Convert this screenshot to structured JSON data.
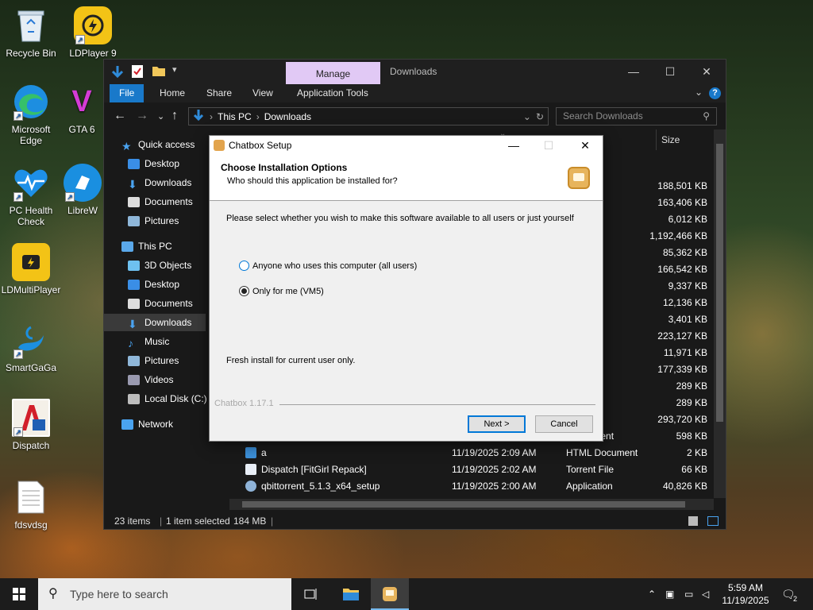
{
  "desktop": {
    "icons": [
      {
        "label": "Recycle Bin",
        "icon": "recycle-bin-icon"
      },
      {
        "label": "LDPlayer 9",
        "icon": "ldplayer-icon"
      },
      {
        "label": "Microsoft Edge",
        "icon": "edge-icon"
      },
      {
        "label": "GTA 6",
        "icon": "gta-icon"
      },
      {
        "label": "PC Health Check",
        "icon": "pc-health-icon"
      },
      {
        "label": "LibreW",
        "icon": "libre-icon"
      },
      {
        "label": "LDMultiPlayer",
        "icon": "ldmultiplayer-icon"
      },
      {
        "label": "SmartGaGa",
        "icon": "smartgaga-icon"
      },
      {
        "label": "Dispatch",
        "icon": "dispatch-icon"
      },
      {
        "label": "fdsvdsg",
        "icon": "text-file-icon"
      }
    ]
  },
  "explorer": {
    "manage_tab": "Manage",
    "window_title": "Downloads",
    "tabs": [
      "File",
      "Home",
      "Share",
      "View",
      "Application Tools"
    ],
    "breadcrumb": [
      "This PC",
      "Downloads"
    ],
    "search_placeholder": "Search Downloads",
    "nav": [
      {
        "label": "Quick access"
      },
      {
        "label": "Desktop"
      },
      {
        "label": "Downloads"
      },
      {
        "label": "Documents"
      },
      {
        "label": "Pictures"
      },
      {
        "label": "This PC"
      },
      {
        "label": "3D Objects"
      },
      {
        "label": "Desktop"
      },
      {
        "label": "Documents"
      },
      {
        "label": "Downloads"
      },
      {
        "label": "Music"
      },
      {
        "label": "Pictures"
      },
      {
        "label": "Videos"
      },
      {
        "label": "Local Disk (C:)"
      },
      {
        "label": "Network"
      }
    ],
    "size_header": "Size",
    "partial_rows": [
      {
        "type": "on",
        "size": "188,501 KB"
      },
      {
        "type": "on",
        "size": "163,406 KB"
      },
      {
        "type": "on",
        "size": "6,012 KB"
      },
      {
        "type": "on",
        "size": "1,192,466 KB"
      },
      {
        "type": "on",
        "size": "85,362 KB"
      },
      {
        "type": "on",
        "size": "166,542 KB"
      },
      {
        "type": "on",
        "size": "9,337 KB"
      },
      {
        "type": "",
        "size": "12,136 KB"
      },
      {
        "type": "on",
        "size": "3,401 KB"
      },
      {
        "type": "",
        "size": "223,127 KB"
      },
      {
        "type": "",
        "size": "11,971 KB"
      },
      {
        "type": "e",
        "size": "177,339 KB"
      },
      {
        "type": "on",
        "size": "289 KB"
      },
      {
        "type": "on",
        "size": "289 KB"
      },
      {
        "type": "on",
        "size": "293,720 KB"
      },
      {
        "type": "ocument",
        "size": "598 KB"
      }
    ],
    "rows": [
      {
        "name": "a",
        "date": "11/19/2025 2:09 AM",
        "type": "HTML Document",
        "size": "2 KB"
      },
      {
        "name": "Dispatch [FitGirl Repack]",
        "date": "11/19/2025 2:02 AM",
        "type": "Torrent File",
        "size": "66 KB"
      },
      {
        "name": "qbittorrent_5.1.3_x64_setup",
        "date": "11/19/2025 2:00 AM",
        "type": "Application",
        "size": "40,826 KB"
      }
    ],
    "status": {
      "items": "23 items",
      "selected": "1 item selected",
      "size": "184 MB"
    }
  },
  "dialog": {
    "title": "Chatbox Setup",
    "heading": "Choose Installation Options",
    "subheading": "Who should this application be installed for?",
    "prompt": "Please select whether you wish to make this software available to all users or just yourself",
    "option_all": "Anyone who uses this computer (all users)",
    "option_me": "Only for me (VM5)",
    "status_text": "Fresh install for current user only.",
    "branding": "Chatbox 1.17.1",
    "next_label": "Next >",
    "cancel_label": "Cancel"
  },
  "taskbar": {
    "search_placeholder": "Type here to search",
    "time": "5:59 AM",
    "date": "11/19/2025",
    "notification_count": "2"
  }
}
